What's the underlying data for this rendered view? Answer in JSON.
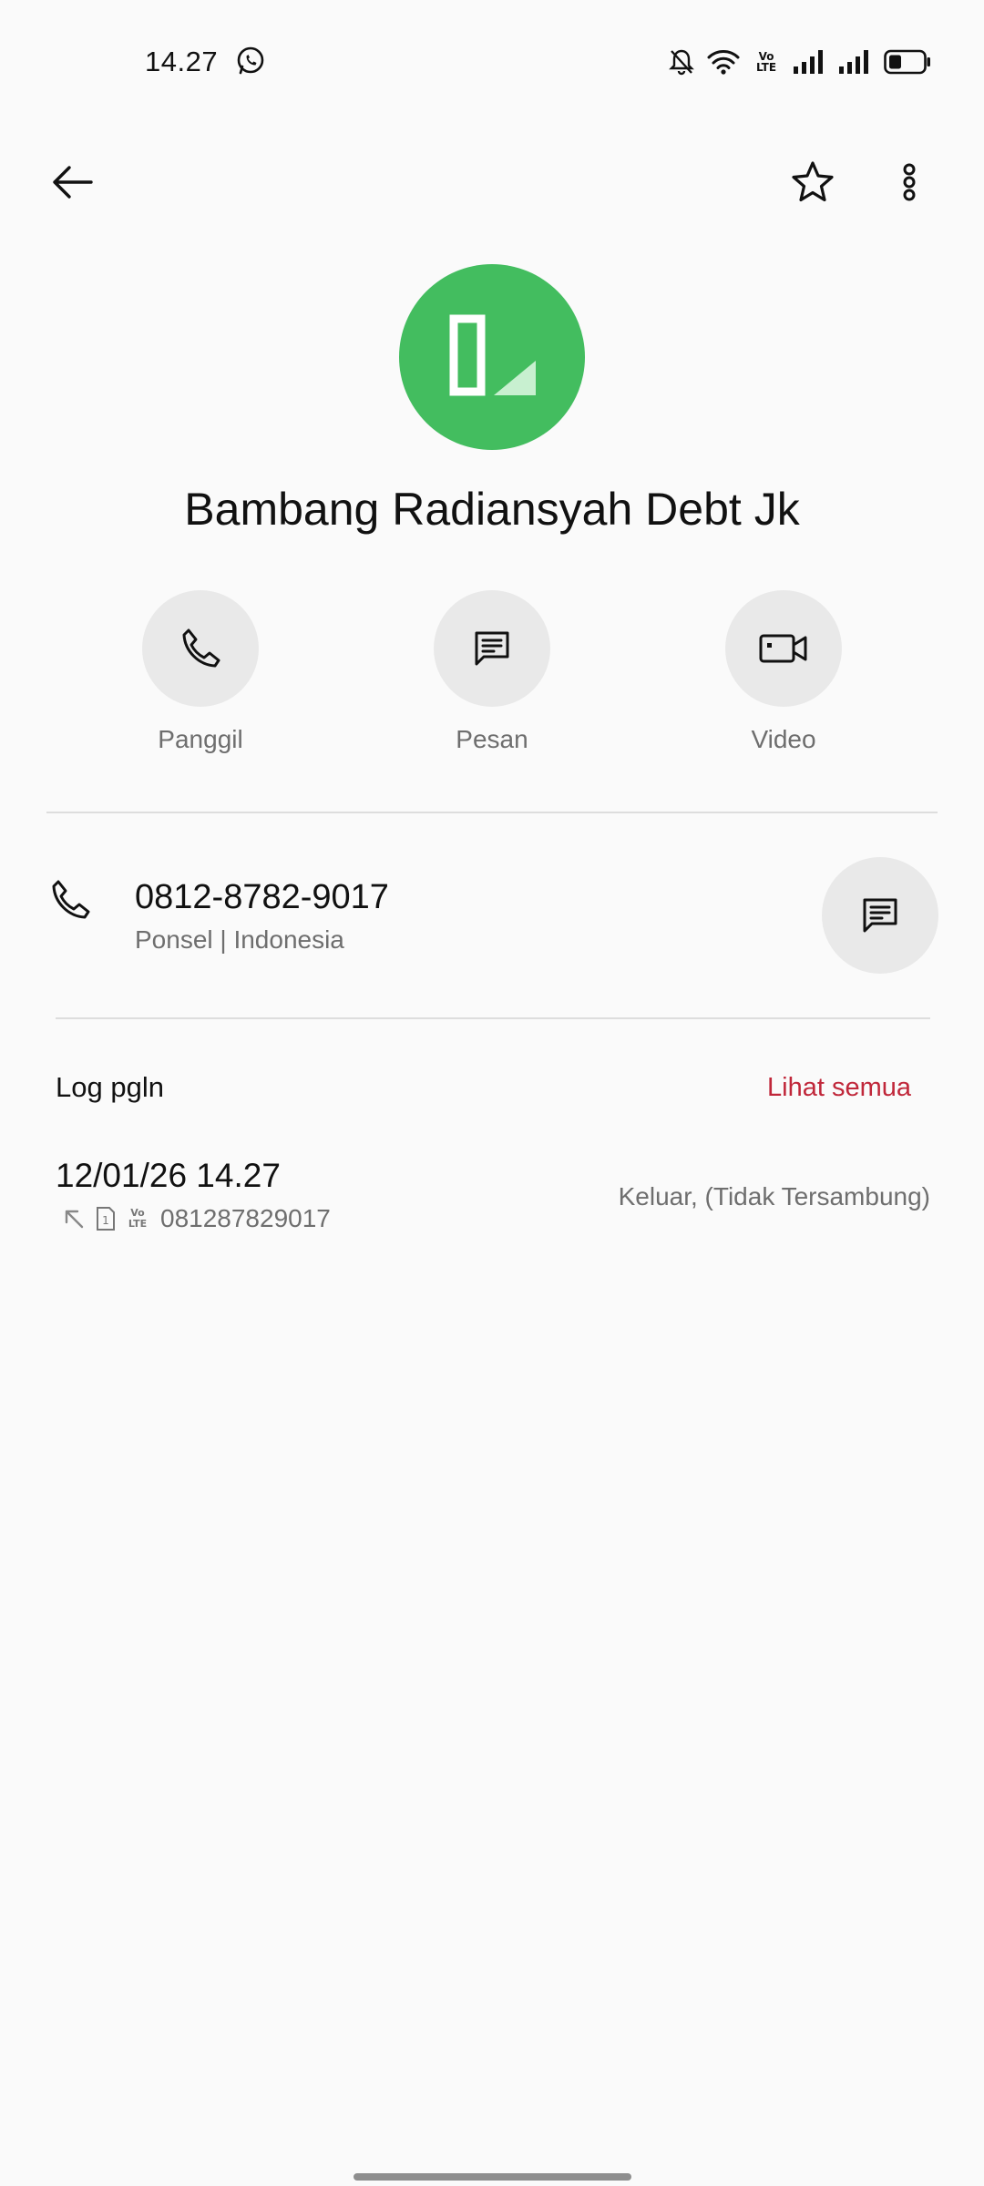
{
  "status_bar": {
    "time": "14.27",
    "volte_line1": "Vo",
    "volte_line2": "LTE"
  },
  "contact": {
    "name": "Bambang Radiansyah Debt Jk",
    "avatar_color": "#43bd5f"
  },
  "actions": {
    "call_label": "Panggil",
    "message_label": "Pesan",
    "video_label": "Video"
  },
  "phone": {
    "number": "0812-8782-9017",
    "type_label": "Ponsel | Indonesia"
  },
  "call_log": {
    "title": "Log pgln",
    "see_all": "Lihat semua",
    "entries": [
      {
        "datetime": "12/01/26 14.27",
        "sim": "1",
        "volte_line1": "Vo",
        "volte_line2": "LTE",
        "number": "081287829017",
        "status": "Keluar, (Tidak Tersambung)"
      }
    ]
  },
  "colors": {
    "accent_red": "#c0273a",
    "button_bg": "#e9e9e9",
    "text_secondary": "#6e6e6e"
  },
  "icons": {
    "back": "arrow-left-icon",
    "favorite": "star-icon",
    "more": "more-vertical-icon",
    "call": "phone-icon",
    "message": "message-icon",
    "video": "video-camera-icon"
  }
}
